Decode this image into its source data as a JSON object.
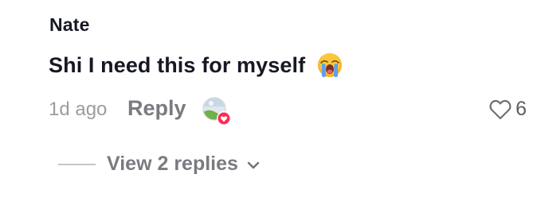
{
  "comment": {
    "author": "Nate",
    "text": "Shi I need this for myself",
    "emoji_icon": "loudly-crying-face-icon",
    "timestamp": "1d ago",
    "reply_label": "Reply",
    "liked_by_creator_icon": "creator-liked-avatar-icon",
    "like_icon": "heart-outline-icon",
    "like_count": "6",
    "view_replies_label": "View 2 replies",
    "view_replies_icon": "chevron-down-icon"
  },
  "colors": {
    "text_primary": "#161823",
    "text_secondary": "#7a7b80",
    "text_muted": "#9b9ca1",
    "like_badge": "#fe2c55"
  }
}
